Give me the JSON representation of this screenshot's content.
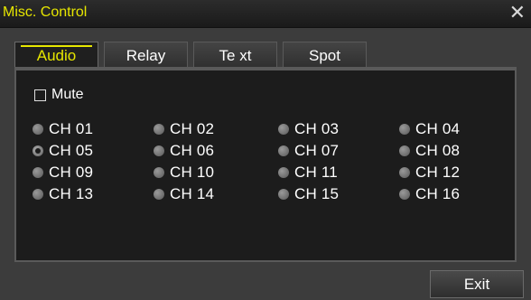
{
  "window": {
    "title": "Misc. Control",
    "close_glyph": "✕",
    "close_icon": "close-icon"
  },
  "tabs": [
    {
      "label": "Audio",
      "active": true
    },
    {
      "label": "Relay",
      "active": false
    },
    {
      "label": "Te xt",
      "active": false
    },
    {
      "label": "Spot",
      "active": false
    }
  ],
  "audio": {
    "mute": {
      "label": "Mute",
      "checked": false
    },
    "selected_channel": "CH 05",
    "channels": [
      "CH 01",
      "CH 02",
      "CH 03",
      "CH 04",
      "CH 05",
      "CH 06",
      "CH 07",
      "CH 08",
      "CH 09",
      "CH 10",
      "CH 11",
      "CH 12",
      "CH 13",
      "CH 14",
      "CH 15",
      "CH 16"
    ]
  },
  "footer": {
    "exit_label": "Exit"
  },
  "colors": {
    "title": "#e6e600",
    "active_tab": "#e6e600",
    "background": "#3c3c3c",
    "panel": "#1c1c1c"
  }
}
